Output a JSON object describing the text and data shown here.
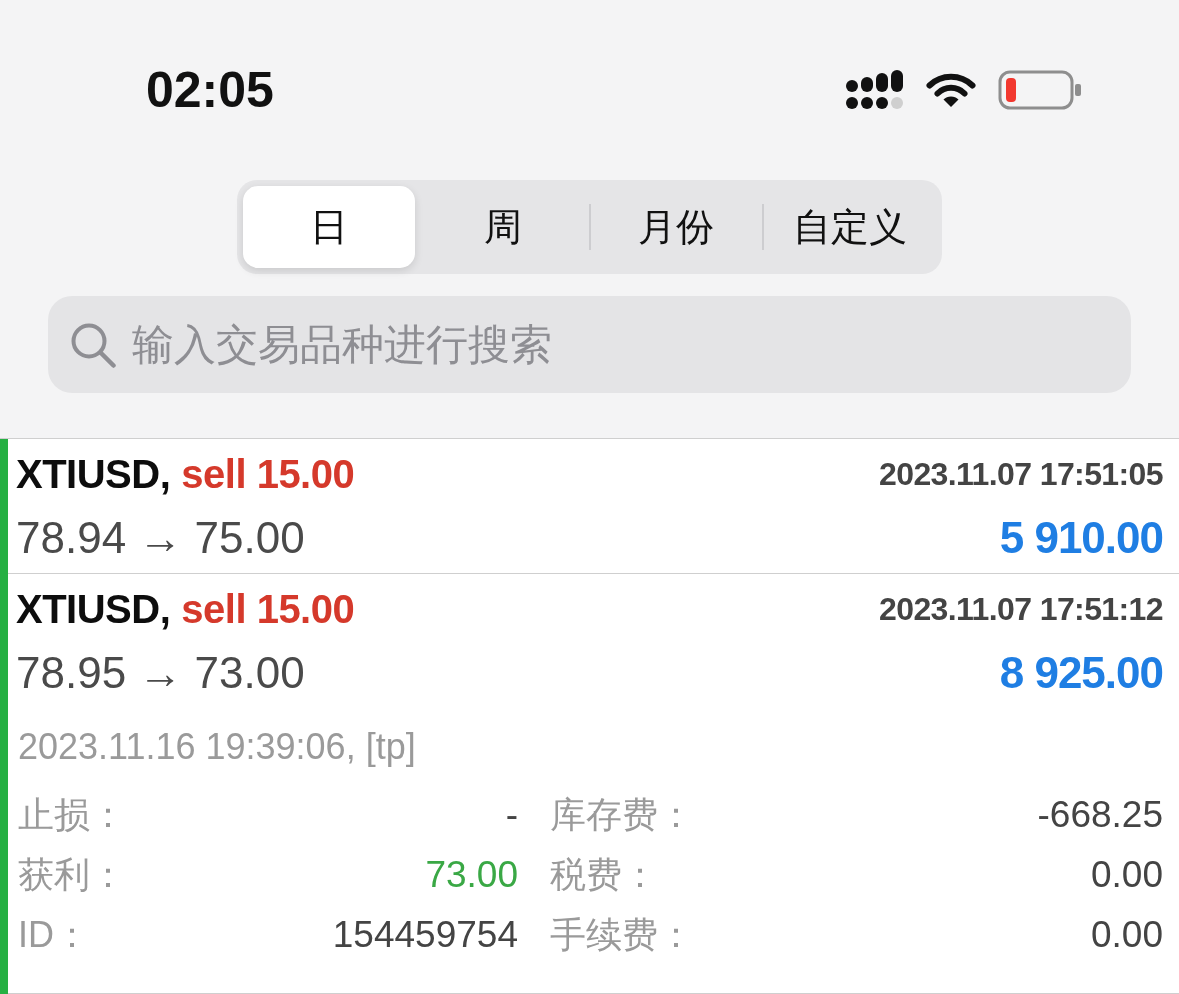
{
  "status_bar": {
    "time": "02:05"
  },
  "tabs": [
    {
      "label": "日",
      "selected": true
    },
    {
      "label": "周",
      "selected": false
    },
    {
      "label": "月份",
      "selected": false
    },
    {
      "label": "自定义",
      "selected": false
    }
  ],
  "search": {
    "placeholder": "输入交易品种进行搜索"
  },
  "trades": [
    {
      "symbol": "XTIUSD,",
      "order": "sell 15.00",
      "open_time": "2023.11.07 17:51:05",
      "prices": "78.94 → 75.00",
      "profit": "5 910.00",
      "expanded": false
    },
    {
      "symbol": "XTIUSD,",
      "order": "sell 15.00",
      "open_time": "2023.11.07 17:51:12",
      "prices": "78.95 → 73.00",
      "profit": "8 925.00",
      "expanded": true,
      "details": {
        "close_info": "2023.11.16 19:39:06, [tp]",
        "columns": [
          {
            "fields": [
              {
                "label": "止损：",
                "value": "-",
                "color": "#444444"
              },
              {
                "label": "获利：",
                "value": "73.00",
                "color": "#3aa845"
              },
              {
                "label": "ID：",
                "value": "154459754",
                "color": "#444444"
              }
            ]
          },
          {
            "fields": [
              {
                "label": "库存费：",
                "value": "-668.25",
                "color": "#444444"
              },
              {
                "label": "税费：",
                "value": "0.00",
                "color": "#444444"
              },
              {
                "label": "手续费：",
                "value": "0.00",
                "color": "#444444"
              }
            ]
          }
        ]
      }
    }
  ]
}
